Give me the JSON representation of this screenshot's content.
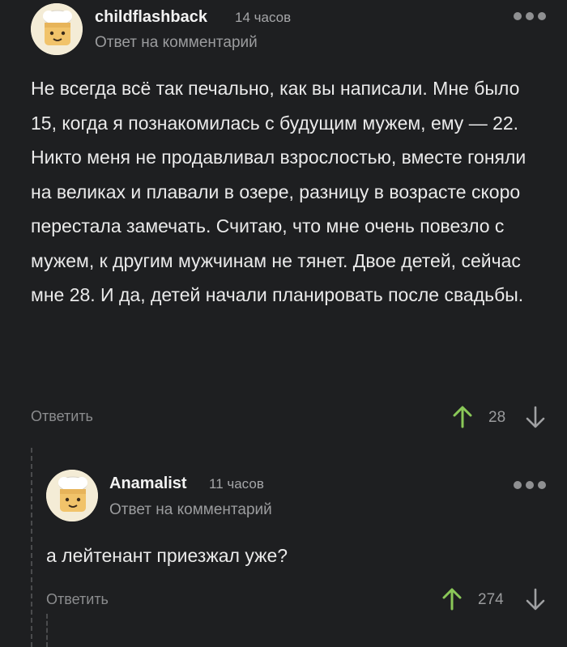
{
  "colors": {
    "background": "#1e1f21",
    "upvote": "#8ac858",
    "muted": "#9b9c9e"
  },
  "comments": [
    {
      "username": "childflashback",
      "time": "14 часов",
      "reply_to": "Ответ на комментарий",
      "text": "Не всегда всё так печально, как вы написали. Мне было 15, когда я познакомилась с будущим мужем, ему — 22. Никто меня не продавливал взрослостью, вместе гоняли на великах и плавали в озере, разницу в возрасте скоро перестала замечать. Считаю, что мне очень повезло с мужем, к другим мужчинам не тянет. Двое детей, сейчас мне 28. И да, детей начали планировать после свадьбы.",
      "reply_label": "Ответить",
      "score": "28",
      "icons": {
        "avatar": "chef-avatar-icon",
        "menu": "more-dots-icon",
        "up": "arrow-up-icon",
        "down": "arrow-down-icon"
      }
    },
    {
      "username": "Anamalist",
      "time": "11 часов",
      "reply_to": "Ответ на комментарий",
      "text": "а лейтенант приезжал уже?",
      "reply_label": "Ответить",
      "score": "274",
      "icons": {
        "avatar": "chef-avatar-icon",
        "menu": "more-dots-icon",
        "up": "arrow-up-icon",
        "down": "arrow-down-icon"
      }
    }
  ]
}
